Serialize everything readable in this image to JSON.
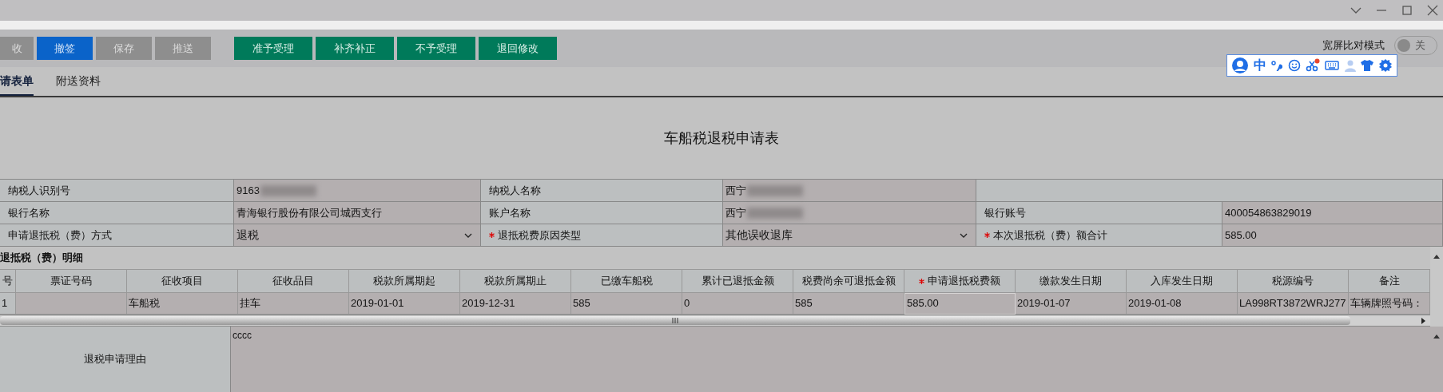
{
  "toolbar": {
    "buttons": [
      {
        "label": "收",
        "kind": "disabled"
      },
      {
        "label": "撤签",
        "kind": "primary"
      },
      {
        "label": "保存",
        "kind": "disabled"
      },
      {
        "label": "推送",
        "kind": "disabled"
      },
      {
        "label": "准予受理",
        "kind": "action"
      },
      {
        "label": "补齐补正",
        "kind": "action"
      },
      {
        "label": "不予受理",
        "kind": "action"
      },
      {
        "label": "退回修改",
        "kind": "action"
      }
    ]
  },
  "widescreen_toggle": {
    "label": "宽屏比对模式",
    "on": false,
    "state_text": "关"
  },
  "ime_toolbar": {
    "mode": "中"
  },
  "tabs": [
    {
      "label": "请表单",
      "selected": true
    },
    {
      "label": "附送资料",
      "selected": false
    }
  ],
  "form": {
    "title": "车船税退税申请表",
    "rows": [
      [
        {
          "kind": "label",
          "text": "纳税人识别号",
          "required": false
        },
        {
          "kind": "value",
          "text": "9163",
          "redacted": true
        },
        {
          "kind": "label",
          "text": "纳税人名称",
          "required": false
        },
        {
          "kind": "value",
          "text": "西宁",
          "redacted": true
        },
        {
          "kind": "empty"
        }
      ],
      [
        {
          "kind": "label",
          "text": "银行名称",
          "required": false
        },
        {
          "kind": "value",
          "text": "青海银行股份有限公司城西支行",
          "redacted": false
        },
        {
          "kind": "label",
          "text": "账户名称",
          "required": false
        },
        {
          "kind": "value",
          "text": "西宁",
          "redacted": true
        },
        {
          "kind": "label",
          "text": "银行账号",
          "required": false
        },
        {
          "kind": "value",
          "text": "400054863829019",
          "redacted": false
        }
      ],
      [
        {
          "kind": "label",
          "text": "申请退抵税（费）方式",
          "required": false
        },
        {
          "kind": "select",
          "text": "退税"
        },
        {
          "kind": "label",
          "text": "退抵税费原因类型",
          "required": true
        },
        {
          "kind": "select",
          "text": "其他误收退库"
        },
        {
          "kind": "label",
          "text": "本次退抵税（费）额合计",
          "required": true
        },
        {
          "kind": "value",
          "text": "585.00",
          "redacted": false
        }
      ]
    ]
  },
  "detail": {
    "title": "退抵税（费）明细",
    "columns": [
      {
        "label": "号",
        "required": false
      },
      {
        "label": "票证号码",
        "required": false
      },
      {
        "label": "征收项目",
        "required": false
      },
      {
        "label": "征收品目",
        "required": false
      },
      {
        "label": "税款所属期起",
        "required": false
      },
      {
        "label": "税款所属期止",
        "required": false
      },
      {
        "label": "已缴车船税",
        "required": false
      },
      {
        "label": "累计已退抵金额",
        "required": false
      },
      {
        "label": "税费尚余可退抵金额",
        "required": false
      },
      {
        "label": "申请退抵税费额",
        "required": true
      },
      {
        "label": "缴款发生日期",
        "required": false
      },
      {
        "label": "入库发生日期",
        "required": false
      },
      {
        "label": "税源编号",
        "required": false
      },
      {
        "label": "备注",
        "required": false
      }
    ],
    "rows": [
      [
        {
          "kind": "text",
          "text": "1"
        },
        {
          "kind": "text",
          "text": ""
        },
        {
          "kind": "text",
          "text": "车船税"
        },
        {
          "kind": "text",
          "text": "挂车"
        },
        {
          "kind": "text",
          "text": "2019-01-01"
        },
        {
          "kind": "text",
          "text": "2019-12-31"
        },
        {
          "kind": "text",
          "text": "585"
        },
        {
          "kind": "text",
          "text": "0"
        },
        {
          "kind": "text",
          "text": "585"
        },
        {
          "kind": "input",
          "text": "585.00"
        },
        {
          "kind": "text",
          "text": "2019-01-07"
        },
        {
          "kind": "text",
          "text": "2019-01-08"
        },
        {
          "kind": "text",
          "text": "LA998RT3872WRJ277"
        },
        {
          "kind": "text",
          "text": "车辆牌照号码："
        }
      ]
    ]
  },
  "reason": {
    "label": "退税申请理由",
    "value": "cccc"
  }
}
